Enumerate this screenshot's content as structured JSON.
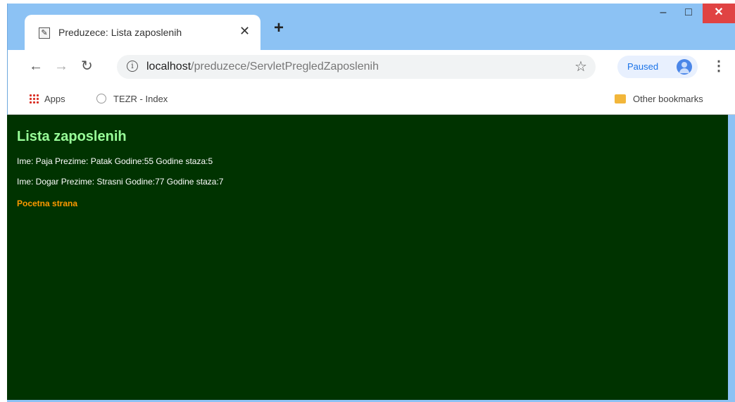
{
  "browser": {
    "tab": {
      "title": "Preduzece: Lista zaposlenih",
      "close": "✕"
    },
    "new_tab": "+",
    "window": {
      "minimize": "–",
      "maximize": "□",
      "close": "✕"
    },
    "url": {
      "host": "localhost",
      "path": "/preduzece/ServletPregledZaposlenih"
    },
    "profile_label": "Paused",
    "bookmarks": {
      "apps": "Apps",
      "index": "TEZR - Index",
      "other": "Other bookmarks"
    }
  },
  "page": {
    "heading": "Lista zaposlenih",
    "employees": [
      "Ime: Paja Prezime: Patak Godine:55 Godine staza:5",
      "Ime: Dogar Prezime: Strasni Godine:77 Godine staza:7"
    ],
    "home_link": "Pocetna strana",
    "colors": {
      "background": "#003300",
      "heading": "#99ff99",
      "link": "#ff9900"
    }
  },
  "icons": [
    "favicon-icon",
    "close-icon",
    "plus-icon",
    "back-icon",
    "forward-icon",
    "reload-icon",
    "info-icon",
    "star-icon",
    "avatar-icon",
    "menu-icon",
    "apps-icon",
    "globe-icon",
    "folder-icon"
  ]
}
